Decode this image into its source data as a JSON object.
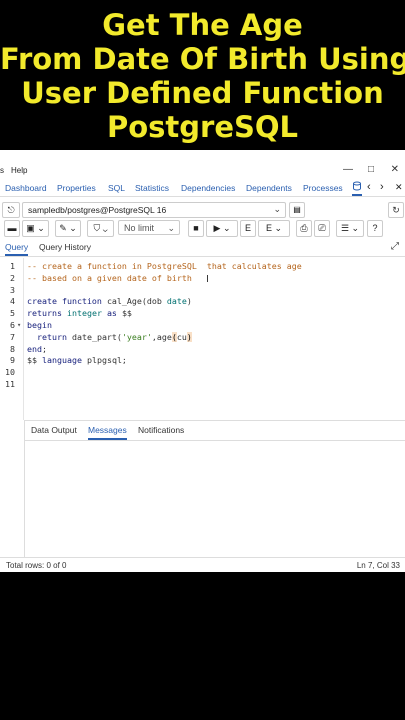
{
  "banner": {
    "line1": "Get The Age",
    "line2": "From Date Of Birth Using",
    "line3": "User Defined Function",
    "line4": "PostgreSQL"
  },
  "menubar": {
    "items": [
      "s",
      "Help"
    ]
  },
  "window_controls": {
    "minimize": "—",
    "maximize": "□",
    "close": "✕"
  },
  "tabs": {
    "items": [
      "Dashboard",
      "Properties",
      "SQL",
      "Statistics",
      "Dependencies",
      "Dependents",
      "Processes"
    ],
    "prev": "‹",
    "next": "›",
    "close": "✕"
  },
  "connection": {
    "value": "sampledb/postgres@PostgreSQL 16",
    "chevron": "⌄"
  },
  "toolbar": {
    "limit": "No limit"
  },
  "query_tabs": {
    "query": "Query",
    "history": "Query History"
  },
  "editor": {
    "lines": [
      {
        "n": "1",
        "fold": "",
        "tokens": [
          {
            "c": "cm",
            "t": "-- create a function in PostgreSQL  that calculates age"
          }
        ]
      },
      {
        "n": "2",
        "fold": "",
        "tokens": [
          {
            "c": "cm",
            "t": "-- based on a given date of birth"
          }
        ]
      },
      {
        "n": "3",
        "fold": "",
        "tokens": []
      },
      {
        "n": "4",
        "fold": "",
        "tokens": [
          {
            "c": "kw",
            "t": "create function "
          },
          {
            "c": "tx",
            "t": "cal_Age(dob "
          },
          {
            "c": "ty",
            "t": "date"
          },
          {
            "c": "tx",
            "t": ")"
          }
        ]
      },
      {
        "n": "5",
        "fold": "",
        "tokens": [
          {
            "c": "kw",
            "t": "returns "
          },
          {
            "c": "ty",
            "t": "integer "
          },
          {
            "c": "kw",
            "t": "as "
          },
          {
            "c": "tx",
            "t": "$$"
          }
        ]
      },
      {
        "n": "6",
        "fold": "▾",
        "tokens": [
          {
            "c": "kw",
            "t": "begin"
          }
        ]
      },
      {
        "n": "7",
        "fold": "",
        "tokens": [
          {
            "c": "tx",
            "t": "  "
          },
          {
            "c": "kw",
            "t": "return "
          },
          {
            "c": "tx",
            "t": "date_part("
          },
          {
            "c": "str",
            "t": "'year'"
          },
          {
            "c": "tx",
            "t": ",age"
          },
          {
            "c": "hl",
            "t": "("
          },
          {
            "c": "tx",
            "t": "cu"
          },
          {
            "c": "hl",
            "t": ")"
          }
        ]
      },
      {
        "n": "8",
        "fold": "",
        "tokens": [
          {
            "c": "kw",
            "t": "end"
          },
          {
            "c": "tx",
            "t": ";"
          }
        ]
      },
      {
        "n": "9",
        "fold": "",
        "tokens": [
          {
            "c": "tx",
            "t": "$$ "
          },
          {
            "c": "kw",
            "t": "language "
          },
          {
            "c": "tx",
            "t": "plpgsql;"
          }
        ]
      },
      {
        "n": "10",
        "fold": "",
        "tokens": []
      },
      {
        "n": "11",
        "fold": "",
        "tokens": []
      }
    ]
  },
  "results": {
    "tabs": [
      "Data Output",
      "Messages",
      "Notifications"
    ],
    "active": "Messages"
  },
  "status": {
    "rows": "Total rows: 0 of 0",
    "position": "Ln 7, Col 33"
  }
}
